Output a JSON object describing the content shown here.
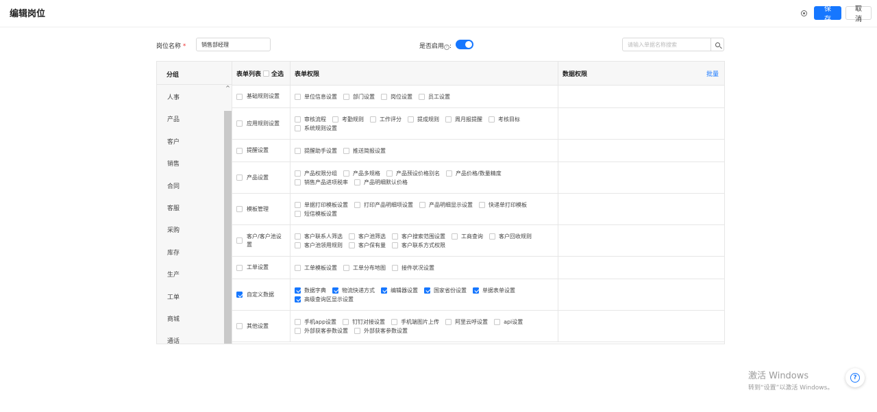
{
  "header": {
    "title": "编辑岗位",
    "save_label": "保存",
    "cancel_label": "取消"
  },
  "form": {
    "position_name_label": "岗位名称",
    "required_mark": "*",
    "position_name_value": "销售部经理",
    "enabled_label": "是否启用",
    "enabled_colon": ":",
    "enabled": true,
    "search_placeholder": "请输入单据名称搜索"
  },
  "groups": {
    "header": "分组",
    "items": [
      {
        "label": "人事"
      },
      {
        "label": "产品"
      },
      {
        "label": "客户"
      },
      {
        "label": "销售"
      },
      {
        "label": "合同"
      },
      {
        "label": "客服"
      },
      {
        "label": "采购"
      },
      {
        "label": "库存"
      },
      {
        "label": "生产"
      },
      {
        "label": "工单"
      },
      {
        "label": "商城"
      },
      {
        "label": "通话"
      }
    ]
  },
  "table": {
    "col_form_list": "表单列表",
    "col_select_all": "全选",
    "col_form_permission": "表单权限",
    "col_data_permission": "数据权限",
    "batch_label": "批量",
    "rows": [
      {
        "label": "基础规则设置",
        "checked": false,
        "height": 33,
        "options": [
          {
            "label": "单位信息设置",
            "checked": false
          },
          {
            "label": "部门设置",
            "checked": false
          },
          {
            "label": "岗位设置",
            "checked": false
          },
          {
            "label": "员工设置",
            "checked": false
          }
        ]
      },
      {
        "label": "应用规则设置",
        "checked": false,
        "height": 46,
        "options": [
          {
            "label": "审核流程",
            "checked": false
          },
          {
            "label": "考勤规则",
            "checked": false
          },
          {
            "label": "工作评分",
            "checked": false
          },
          {
            "label": "提成规则",
            "checked": false
          },
          {
            "label": "周月报提醒",
            "checked": false
          },
          {
            "label": "考核目标",
            "checked": false
          },
          {
            "label": "系统规则设置",
            "checked": false
          }
        ]
      },
      {
        "label": "提醒设置",
        "checked": false,
        "height": 33,
        "options": [
          {
            "label": "提醒助手设置",
            "checked": false
          },
          {
            "label": "推送简报设置",
            "checked": false
          }
        ]
      },
      {
        "label": "产品设置",
        "checked": false,
        "height": 46,
        "options": [
          {
            "label": "产品权限分组",
            "checked": false
          },
          {
            "label": "产品多规格",
            "checked": false
          },
          {
            "label": "产品预设价格别名",
            "checked": false
          },
          {
            "label": "产品价格/数量精度",
            "checked": false
          },
          {
            "label": "销售产品进项税率",
            "checked": false
          },
          {
            "label": "产品明细默认价格",
            "checked": false
          }
        ]
      },
      {
        "label": "模板管理",
        "checked": false,
        "height": 46,
        "options": [
          {
            "label": "单据打印模板设置",
            "checked": false
          },
          {
            "label": "打印产品明细项设置",
            "checked": false
          },
          {
            "label": "产品明细显示设置",
            "checked": false
          },
          {
            "label": "快递单打印模板",
            "checked": false
          },
          {
            "label": "短信模板设置",
            "checked": false
          }
        ]
      },
      {
        "label": "客户/客户池设置",
        "checked": false,
        "height": 46,
        "options": [
          {
            "label": "客户联系人筛选",
            "checked": false
          },
          {
            "label": "客户池筛选",
            "checked": false
          },
          {
            "label": "客户搜索范围设置",
            "checked": false
          },
          {
            "label": "工商查询",
            "checked": false
          },
          {
            "label": "客户回收规则",
            "checked": false
          },
          {
            "label": "客户池领用规则",
            "checked": false
          },
          {
            "label": "客户保有量",
            "checked": false
          },
          {
            "label": "客户联系方式权限",
            "checked": false
          }
        ]
      },
      {
        "label": "工单设置",
        "checked": false,
        "height": 33,
        "options": [
          {
            "label": "工单模板设置",
            "checked": false
          },
          {
            "label": "工单分布地图",
            "checked": false
          },
          {
            "label": "接件状况设置",
            "checked": false
          }
        ]
      },
      {
        "label": "自定义数据",
        "checked": true,
        "height": 46,
        "options": [
          {
            "label": "数据字典",
            "checked": true
          },
          {
            "label": "物流快递方式",
            "checked": true
          },
          {
            "label": "编辑器设置",
            "checked": true
          },
          {
            "label": "国家省份设置",
            "checked": true
          },
          {
            "label": "单据表单设置",
            "checked": true
          },
          {
            "label": "高级查询区显示设置",
            "checked": true
          }
        ]
      },
      {
        "label": "其他设置",
        "checked": false,
        "height": 46,
        "options": [
          {
            "label": "手机app设置",
            "checked": false
          },
          {
            "label": "钉钉对接设置",
            "checked": false
          },
          {
            "label": "手机端图片上传",
            "checked": false
          },
          {
            "label": "阿里云呼设置",
            "checked": false
          },
          {
            "label": "api设置",
            "checked": false
          },
          {
            "label": "外部获客参数设置",
            "checked": false
          },
          {
            "label": "外部获客参数设置",
            "checked": false
          }
        ]
      }
    ]
  },
  "watermark": {
    "line1": "激活 Windows",
    "line2": "转到“设置”以激活 Windows。"
  },
  "colors": {
    "primary": "#1677ff",
    "border": "#e6e6e6",
    "header_bg": "#f7f7f7"
  }
}
